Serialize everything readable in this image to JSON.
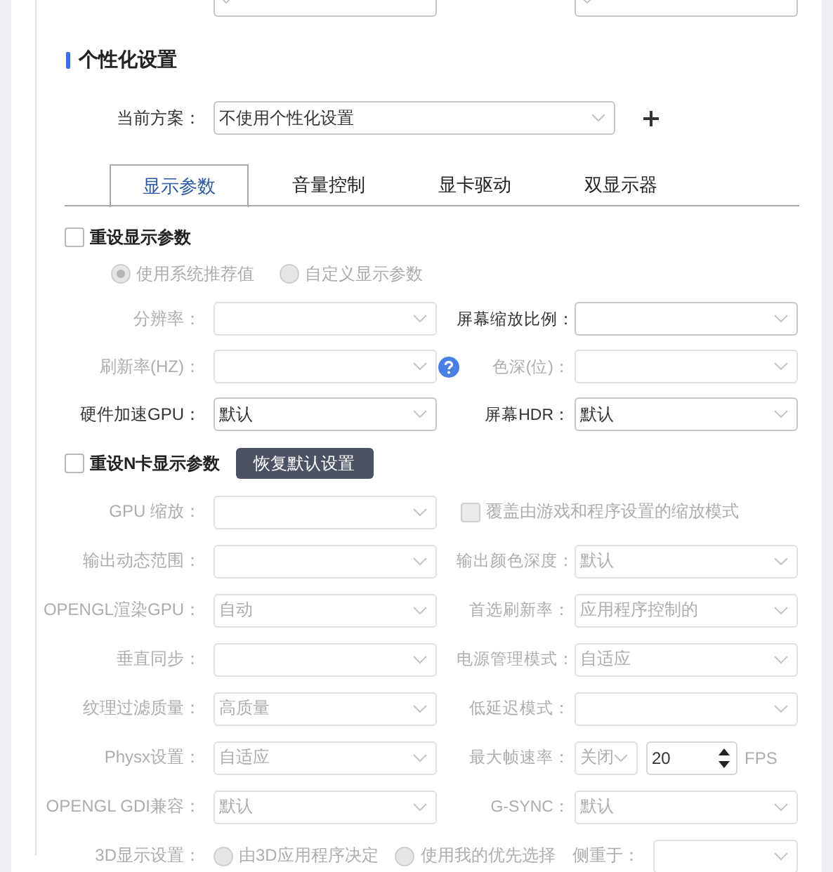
{
  "section_title": "个性化设置",
  "scheme": {
    "label": "当前方案：",
    "value": "不使用个性化设置"
  },
  "tabs": [
    {
      "label": "显示参数",
      "selected": true
    },
    {
      "label": "音量控制",
      "selected": false
    },
    {
      "label": "显卡驱动",
      "selected": false
    },
    {
      "label": "双显示器",
      "selected": false
    }
  ],
  "display": {
    "checkbox": {
      "label": "重设显示参数",
      "checked": false
    },
    "radios": [
      {
        "label": "使用系统推荐值",
        "selected": true,
        "disabled": true
      },
      {
        "label": "自定义显示参数",
        "selected": false,
        "disabled": true
      }
    ],
    "rows": [
      {
        "help": false,
        "fields": [
          {
            "kind": "select",
            "label": "分辨率：",
            "disabled": true
          },
          {
            "kind": "select",
            "label": "屏幕缩放比例：",
            "disabled": false
          }
        ]
      },
      {
        "help": true,
        "fields": [
          {
            "kind": "select",
            "label": "刷新率(HZ)：",
            "disabled": true
          },
          {
            "kind": "select",
            "label": "色深(位)：",
            "disabled": true
          }
        ]
      },
      {
        "help": false,
        "fields": [
          {
            "kind": "select",
            "label": "硬件加速GPU：",
            "value": "默认",
            "disabled": false
          },
          {
            "kind": "select",
            "label": "屏幕HDR：",
            "value": "默认",
            "disabled": false
          }
        ]
      }
    ]
  },
  "nvidia": {
    "checkbox": {
      "label": "重设N卡显示参数",
      "checked": false
    },
    "button": "恢复默认设置",
    "rows": [
      {
        "kind": "fields",
        "fields": [
          {
            "kind": "select",
            "label": "GPU 缩放：",
            "disabled": true
          },
          {
            "kind": "checkbox",
            "label": "覆盖由游戏和程序设置的缩放模式",
            "checked": false,
            "disabled": true
          }
        ]
      },
      {
        "kind": "fields",
        "fields": [
          {
            "kind": "select",
            "label": "输出动态范围：",
            "disabled": true
          },
          {
            "kind": "select",
            "label": "输出颜色深度：",
            "value": "默认",
            "disabled": true
          }
        ]
      },
      {
        "kind": "fields",
        "fields": [
          {
            "kind": "select",
            "label": "OPENGL渲染GPU：",
            "value": "自动",
            "disabled": true
          },
          {
            "kind": "select",
            "label": "首选刷新率：",
            "value": "应用程序控制的",
            "disabled": true
          }
        ]
      },
      {
        "kind": "fields",
        "fields": [
          {
            "kind": "select",
            "label": "垂直同步：",
            "disabled": true
          },
          {
            "kind": "select",
            "label": "电源管理模式：",
            "value": "自适应",
            "disabled": true
          }
        ]
      },
      {
        "kind": "fields",
        "fields": [
          {
            "kind": "select",
            "label": "纹理过滤质量：",
            "value": "高质量",
            "disabled": true
          },
          {
            "kind": "select",
            "label": "低延迟模式：",
            "disabled": true
          }
        ]
      },
      {
        "kind": "fields",
        "fields": [
          {
            "kind": "select",
            "label": "Physx设置：",
            "value": "自适应",
            "disabled": true
          },
          {
            "kind": "fps",
            "label": "最大帧速率：",
            "value": "关闭",
            "number": "20",
            "unit": "FPS",
            "disabled": true
          }
        ]
      },
      {
        "kind": "fields",
        "fields": [
          {
            "kind": "select",
            "label": "OPENGL GDI兼容：",
            "value": "默认",
            "disabled": true
          },
          {
            "kind": "select",
            "label": "G-SYNC：",
            "value": "默认",
            "disabled": true
          }
        ]
      },
      {
        "kind": "radios",
        "label": "3D显示设置：",
        "disabled": true,
        "options": [
          {
            "label": "由3D应用程序决定",
            "selected": false
          },
          {
            "label": "使用我的优先选择",
            "selected": false
          }
        ],
        "focus_label": "侧重于："
      }
    ]
  }
}
